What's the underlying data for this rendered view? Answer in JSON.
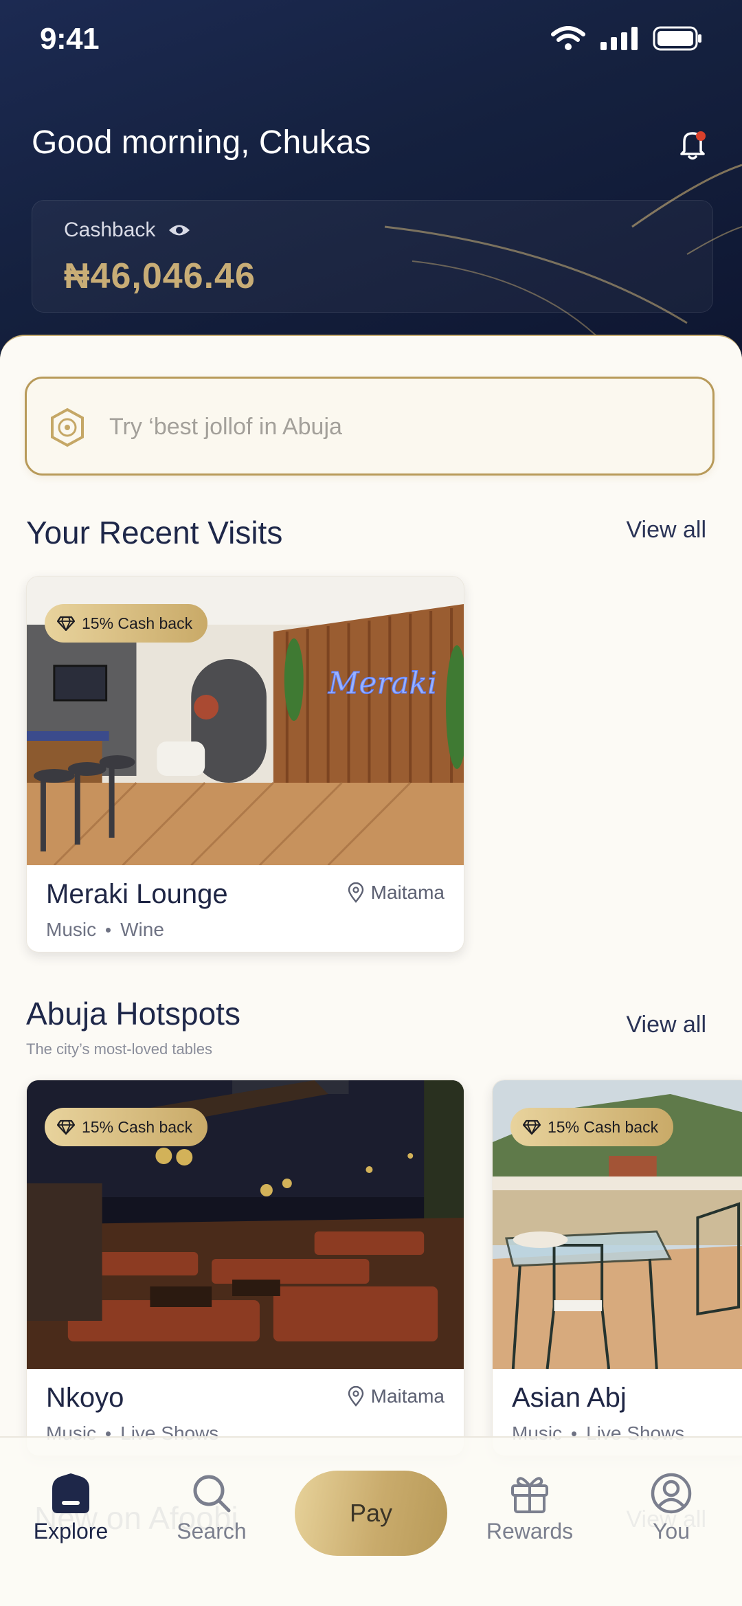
{
  "status_bar": {
    "time": "9:41"
  },
  "header": {
    "greeting": "Good morning, Chukas",
    "cashback_label": "Cashback",
    "cashback_value": "₦46,046.46"
  },
  "search": {
    "placeholder": "Try ‘best jollof in Abuja"
  },
  "recent_visits": {
    "title": "Your Recent Visits",
    "view_all": "View all",
    "items": [
      {
        "badge": "15% Cash back",
        "name": "Meraki Lounge",
        "location": "Maitama",
        "tags": [
          "Music",
          "Wine"
        ]
      }
    ]
  },
  "hotspots": {
    "title": "Abuja Hotspots",
    "subtitle": "The city’s most-loved tables",
    "view_all": "View all",
    "items": [
      {
        "badge": "15% Cash back",
        "name": "Nkoyo",
        "location": "Maitama",
        "tags": [
          "Music",
          "Live Shows"
        ]
      },
      {
        "badge": "15% Cash back",
        "name": "Asian Abj",
        "location": "",
        "tags": [
          "Music",
          "Live Shows"
        ]
      }
    ]
  },
  "new_section": {
    "title": "New on Afoobi",
    "view_all": "View all"
  },
  "nav": {
    "items": [
      {
        "label": "Explore",
        "icon": "home-icon",
        "active": true
      },
      {
        "label": "Search",
        "icon": "search-icon",
        "active": false
      },
      {
        "label": "Pay",
        "icon": "",
        "active": false
      },
      {
        "label": "Rewards",
        "icon": "gift-icon",
        "active": false
      },
      {
        "label": "You",
        "icon": "profile-icon",
        "active": false
      }
    ]
  },
  "colors": {
    "navy": "#15213f",
    "gold": "#c8ad76",
    "background": "#fcfaf5"
  }
}
